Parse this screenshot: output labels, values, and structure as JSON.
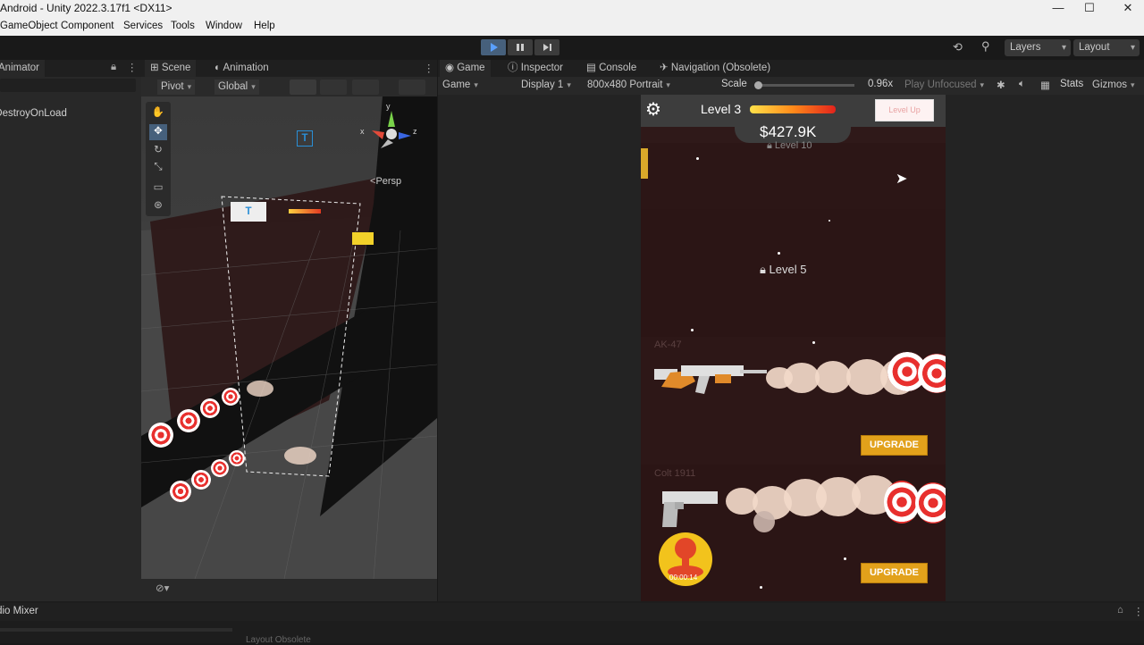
{
  "window": {
    "title": "Android - Unity 2022.3.17f1 <DX11>"
  },
  "menu": [
    "GameObject",
    "Component",
    "Services",
    "Tools",
    "Window",
    "Help"
  ],
  "toolbar": {
    "layers": "Layers",
    "layout": "Layout"
  },
  "hierarchy": {
    "tab": "Animator",
    "item": "DontDestroyOnLoad"
  },
  "scene": {
    "tabs": [
      "Scene",
      "Animation"
    ],
    "pivot": "Pivot",
    "global": "Global",
    "persp": "Persp",
    "axes": [
      "x",
      "y",
      "z"
    ]
  },
  "game": {
    "tabs": [
      "Game",
      "Inspector",
      "Console",
      "Navigation (Obsolete)"
    ],
    "mode": "Game",
    "display": "Display 1",
    "resolution": "800x480 Portrait",
    "scale_label": "Scale",
    "scale_value": "0.96x",
    "play_unfocused": "Play Unfocused",
    "stats": "Stats",
    "gizmos": "Gizmos"
  },
  "hud": {
    "level": "Level 3",
    "money": "$427.9K",
    "level_up": "Level Up",
    "locked_top": "Level 10",
    "locked_mid": "Level 5"
  },
  "weapons": [
    {
      "name": "AK-47",
      "button": "UPGRADE"
    },
    {
      "name": "Colt 1911",
      "button": "UPGRADE",
      "timer": "00:00:14"
    }
  ],
  "bottom": {
    "tab": "Audio Mixer",
    "footer": "Layout Obsolete"
  },
  "colors": {
    "accent": "#46607c",
    "upgrade": "#e2a11b",
    "lane": "#2f1919"
  }
}
